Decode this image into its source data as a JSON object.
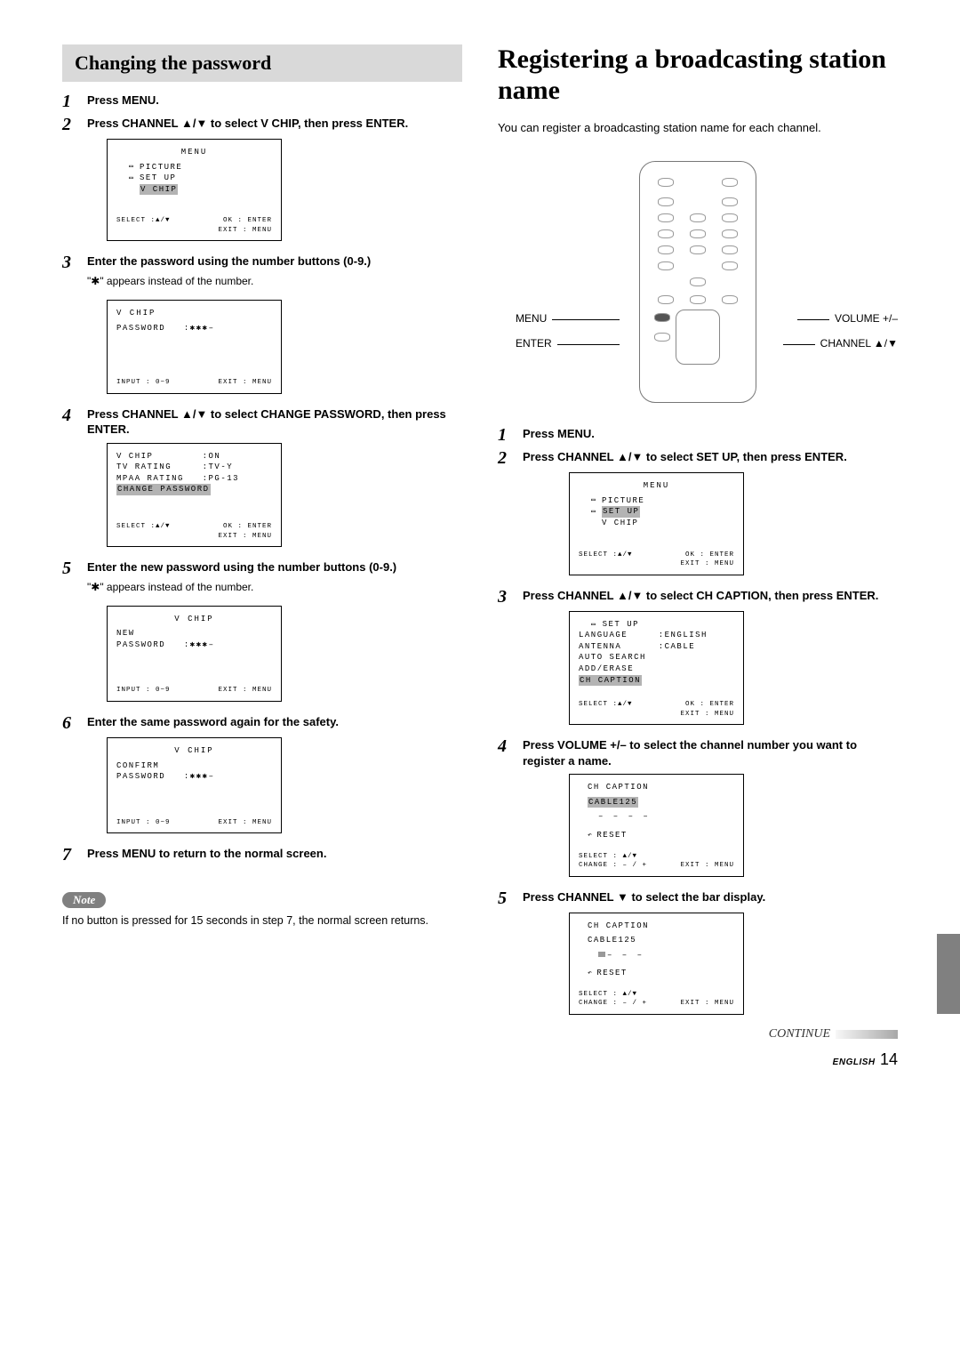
{
  "left": {
    "header": "Changing the password",
    "steps": [
      {
        "num": "1",
        "bold": "Press MENU."
      },
      {
        "num": "2",
        "bold": "Press CHANNEL ▲/▼ to select V CHIP, then press ENTER."
      },
      {
        "num": "3",
        "bold": "Enter the password using the number buttons (0-9.)",
        "note": "\"✱\" appears instead of the number."
      },
      {
        "num": "4",
        "bold": "Press CHANNEL ▲/▼ to select CHANGE PASSWORD, then press ENTER."
      },
      {
        "num": "5",
        "bold": "Enter the new password using the number buttons (0-9.)",
        "note": "\"✱\" appears instead of the number."
      },
      {
        "num": "6",
        "bold": "Enter the same password again for the safety."
      },
      {
        "num": "7",
        "bold": "Press MENU to return to the normal screen."
      }
    ],
    "osd1": {
      "title": "MENU",
      "items": [
        "PICTURE",
        "SET UP",
        "V CHIP"
      ],
      "hl": "V CHIP",
      "fl": "SELECT :▲/▼",
      "fr1": "OK : ENTER",
      "fr2": "EXIT : MENU"
    },
    "osd2": {
      "title": "V CHIP",
      "line": "PASSWORD   :✱✱✱–",
      "fl": "INPUT : 0~9",
      "fr": "EXIT : MENU"
    },
    "osd3": {
      "title": "",
      "lines": [
        "V CHIP        :ON",
        "TV RATING     :TV-Y",
        "MPAA RATING   :PG-13"
      ],
      "hl": "CHANGE PASSWORD",
      "fl": "SELECT :▲/▼",
      "fr1": "OK : ENTER",
      "fr2": "EXIT : MENU"
    },
    "osd4": {
      "title": "V CHIP",
      "l1": "NEW",
      "l2": "PASSWORD   :✱✱✱–",
      "fl": "INPUT : 0~9",
      "fr": "EXIT : MENU"
    },
    "osd5": {
      "title": "V CHIP",
      "l1": "CONFIRM",
      "l2": "PASSWORD   :✱✱✱–",
      "fl": "INPUT : 0~9",
      "fr": "EXIT : MENU"
    },
    "notePill": "Note",
    "noteText": "If no button is pressed for 15 seconds in step 7, the normal screen returns."
  },
  "right": {
    "title": "Registering a broadcasting station name",
    "intro": "You can register a broadcasting station name for each channel.",
    "remoteLabels": {
      "menu": "MENU",
      "enter": "ENTER",
      "vol": "VOLUME +/–",
      "ch": "CHANNEL ▲/▼"
    },
    "steps": [
      {
        "num": "1",
        "bold": "Press MENU."
      },
      {
        "num": "2",
        "bold": "Press CHANNEL ▲/▼ to select SET UP, then press ENTER."
      },
      {
        "num": "3",
        "bold": "Press CHANNEL ▲/▼ to select CH CAPTION, then press ENTER."
      },
      {
        "num": "4",
        "bold": "Press VOLUME +/– to select the channel number you want to register a name."
      },
      {
        "num": "5",
        "bold": "Press CHANNEL ▼ to select the bar display."
      }
    ],
    "osd1": {
      "title": "MENU",
      "items": [
        "PICTURE",
        "SET UP",
        "V CHIP"
      ],
      "hl": "SET UP",
      "fl": "SELECT :▲/▼",
      "fr1": "OK : ENTER",
      "fr2": "EXIT : MENU"
    },
    "osd2": {
      "title": "SET UP",
      "lines": [
        "LANGUAGE     :ENGLISH",
        "ANTENNA      :CABLE",
        "AUTO SEARCH",
        "ADD/ERASE"
      ],
      "hl": "CH CAPTION",
      "fl": "SELECT :▲/▼",
      "fr1": "OK : ENTER",
      "fr2": "EXIT : MENU"
    },
    "osd3": {
      "title": "CH CAPTION",
      "ch": "CABLE125",
      "dash": "– – – –",
      "reset": "RESET",
      "fl": "SELECT : ▲/▼",
      "fl2": "CHANGE : – / +",
      "fr": "EXIT : MENU"
    },
    "osd4": {
      "title": "CH CAPTION",
      "ch": "CABLE125",
      "dash": "– – –",
      "reset": "RESET",
      "fl": "SELECT : ▲/▼",
      "fl2": "CHANGE : – / +",
      "fr": "EXIT : MENU"
    }
  },
  "footer": {
    "continue": "CONTINUE",
    "lang": "ENGLISH",
    "page": "14"
  }
}
